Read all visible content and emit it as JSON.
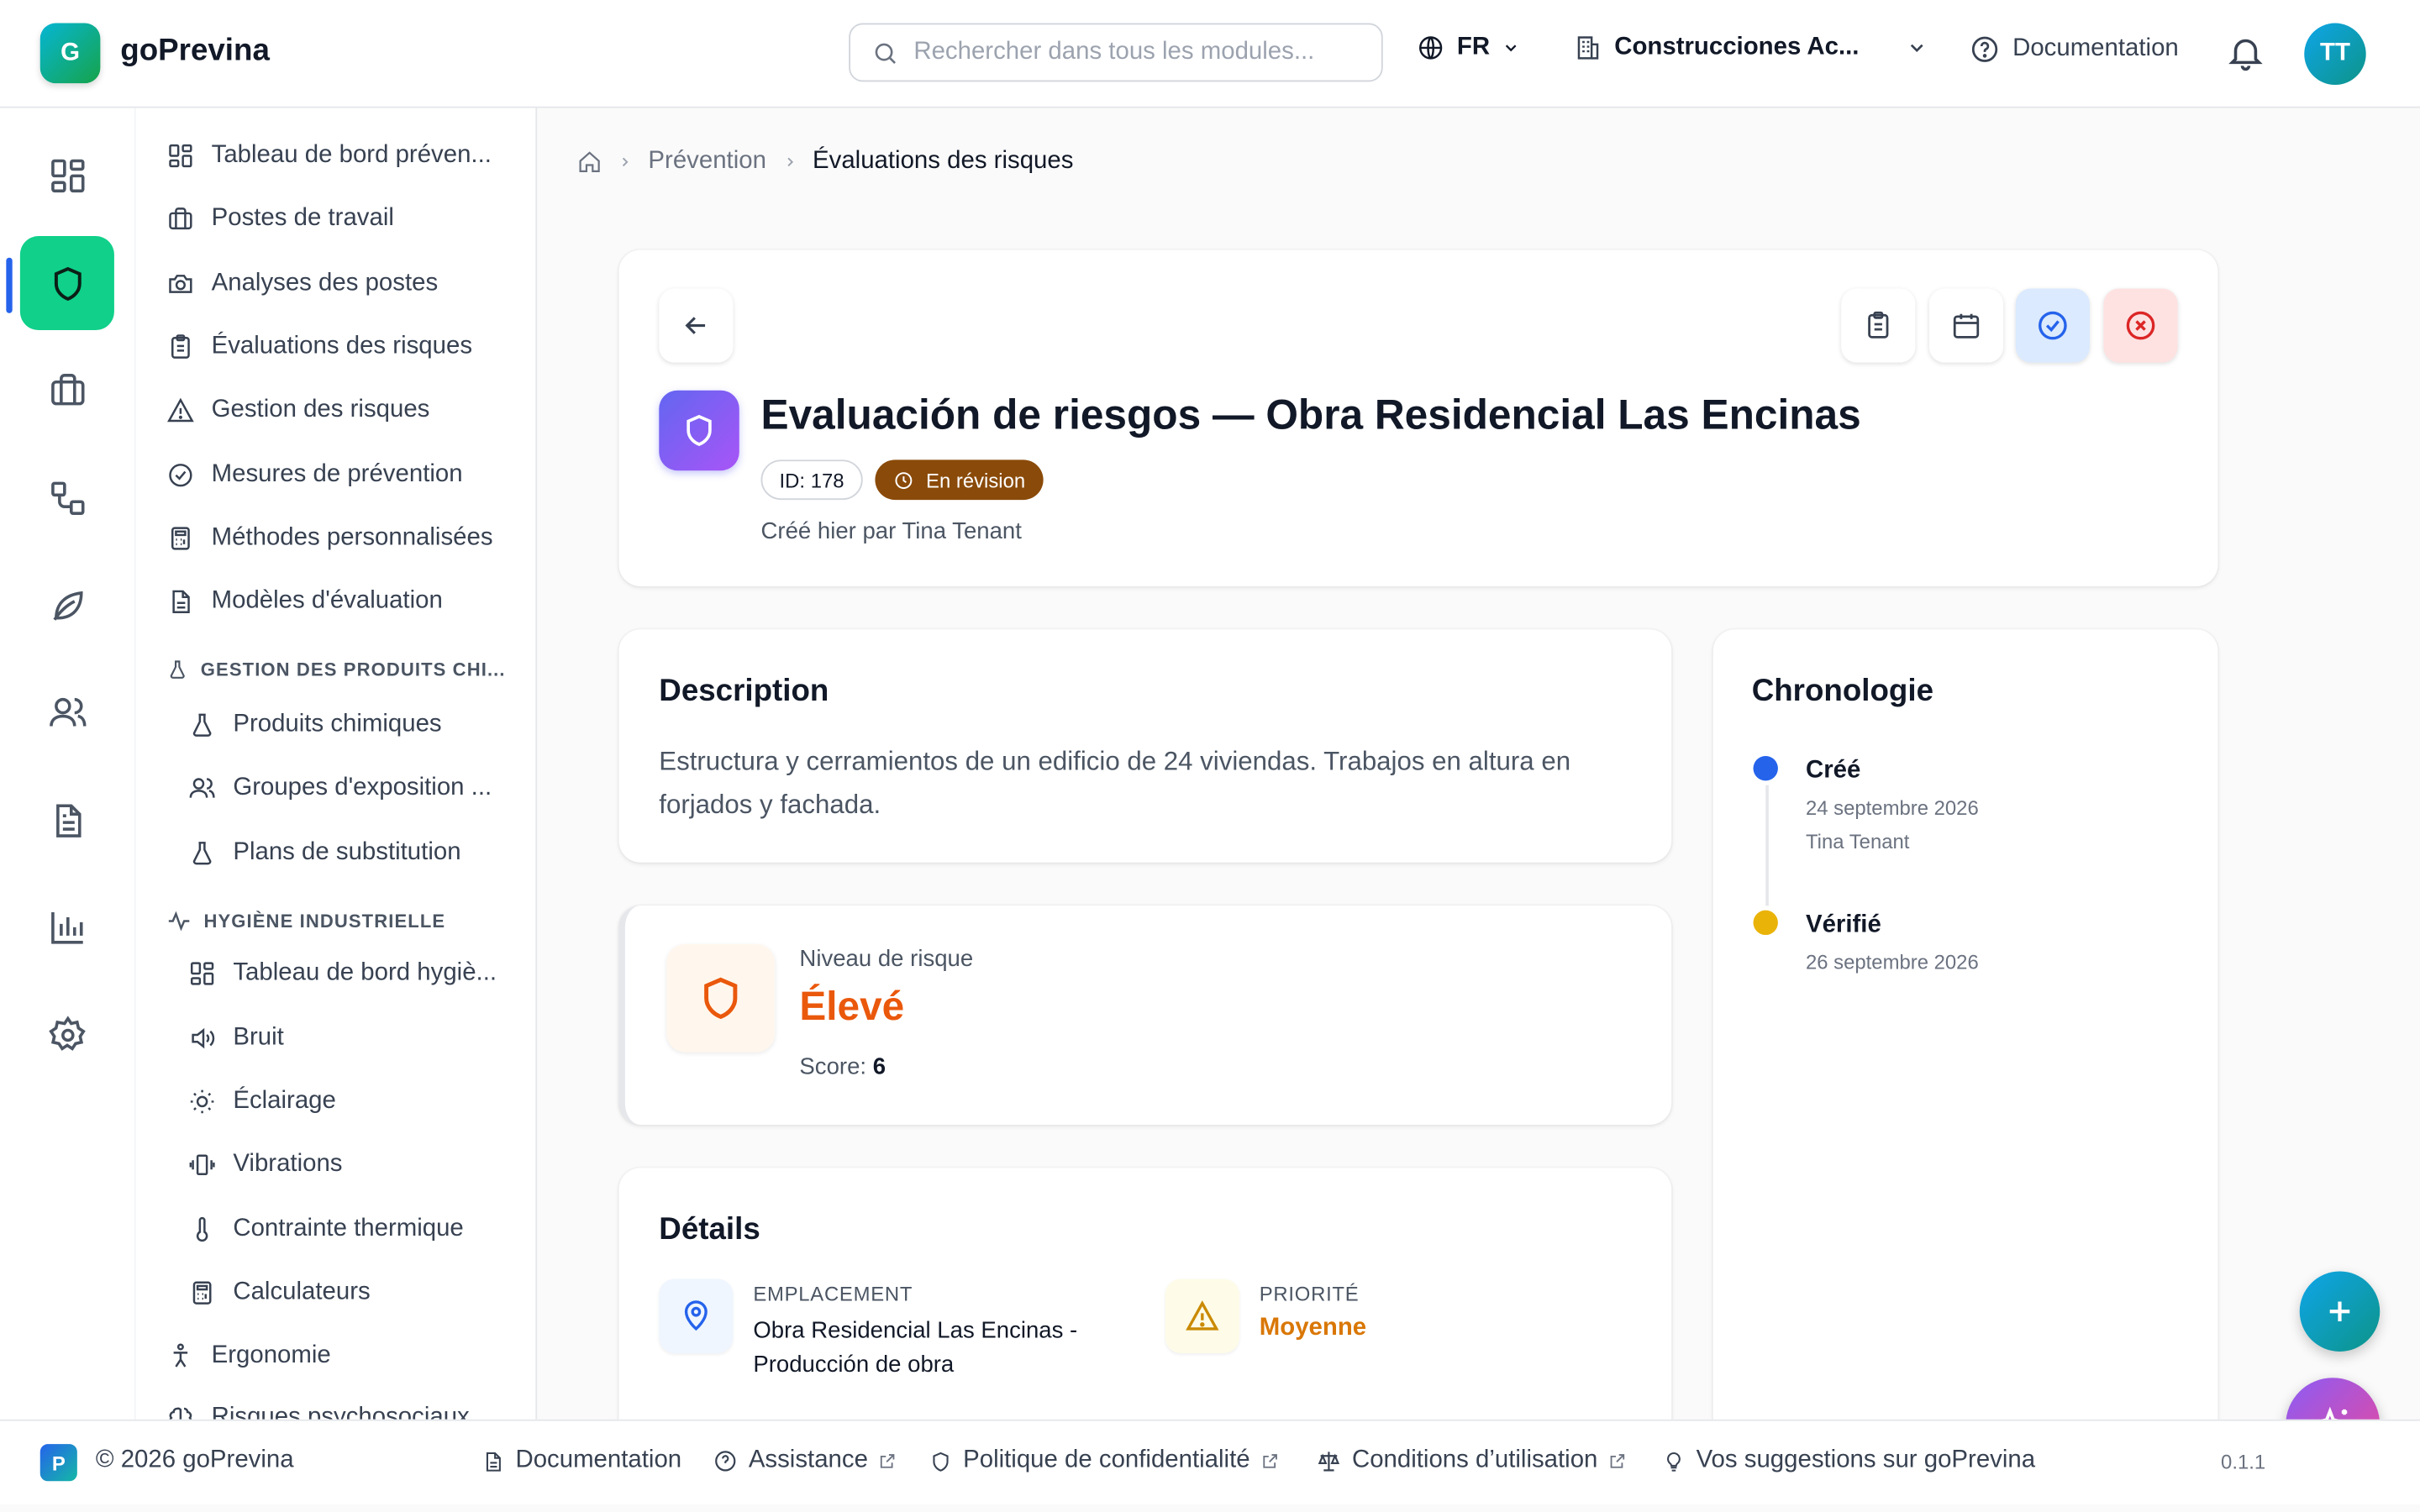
{
  "header": {
    "logo_letter": "G",
    "app_name": "goPrevina",
    "search_placeholder": "Rechercher dans tous les modules...",
    "language": "FR",
    "company": "Construcciones Ac...",
    "documentation": "Documentation",
    "avatar_initials": "TT"
  },
  "rail": {
    "icons": [
      "dashboard-icon",
      "shield-icon",
      "briefcase-icon",
      "workflow-icon",
      "leaf-icon",
      "users-icon",
      "file-text-icon",
      "bar-chart-icon",
      "settings-icon"
    ],
    "active": "shield-icon"
  },
  "sidebar": {
    "items": [
      {
        "label": "Tableau de bord préven...",
        "icon": "dashboard-icon"
      },
      {
        "label": "Postes de travail",
        "icon": "briefcase-icon"
      },
      {
        "label": "Analyses des postes",
        "icon": "camera-icon"
      },
      {
        "label": "Évaluations des risques",
        "icon": "clipboard-icon"
      },
      {
        "label": "Gestion des risques",
        "icon": "warning-icon"
      },
      {
        "label": "Mesures de prévention",
        "icon": "check-circle-icon"
      },
      {
        "label": "Méthodes personnalisées",
        "icon": "calculator-icon"
      },
      {
        "label": "Modèles d'évaluation",
        "icon": "file-icon"
      }
    ],
    "section_chemicals": "GESTION DES PRODUITS CHI...",
    "chemicals": [
      {
        "label": "Produits chimiques",
        "icon": "flask-icon"
      },
      {
        "label": "Groupes d'exposition ...",
        "icon": "users-icon"
      },
      {
        "label": "Plans de substitution",
        "icon": "flask-icon"
      }
    ],
    "section_hygiene": "HYGIÈNE INDUSTRIELLE",
    "hygiene": [
      {
        "label": "Tableau de bord hygiè...",
        "icon": "dashboard-icon"
      },
      {
        "label": "Bruit",
        "icon": "speaker-icon"
      },
      {
        "label": "Éclairage",
        "icon": "sun-icon"
      },
      {
        "label": "Vibrations",
        "icon": "vibration-icon"
      },
      {
        "label": "Contrainte thermique",
        "icon": "thermometer-icon"
      },
      {
        "label": "Calculateurs",
        "icon": "calculator-icon"
      }
    ],
    "ergonomie": "Ergonomie",
    "cut_item": "Risques psychosociaux"
  },
  "breadcrumb": {
    "parent": "Prévention",
    "current": "Évaluations des risques"
  },
  "evaluation": {
    "title": "Evaluación de riesgos — Obra Residencial Las Encinas",
    "id_label": "ID: 178",
    "status": "En révision",
    "created_line": "Créé hier par Tina Tenant",
    "status_color": "#8a4a09"
  },
  "description": {
    "heading": "Description",
    "text": "Estructura y cerramientos de un edificio de 24 viviendas. Trabajos en altura en forjados y fachada."
  },
  "risk": {
    "label": "Niveau de risque",
    "level": "Élevé",
    "score_label": "Score:",
    "score_value": "6",
    "level_color": "#ea580c"
  },
  "details": {
    "heading": "Détails",
    "location_label": "EMPLACEMENT",
    "location_value": "Obra Residencial Las Encinas - Producción de obra",
    "priority_label": "PRIORITÉ",
    "priority_value": "Moyenne",
    "priority_color": "#d97706"
  },
  "timeline": {
    "heading": "Chronologie",
    "events": [
      {
        "title": "Créé",
        "date": "24 septembre 2026",
        "user": "Tina Tenant",
        "color": "#2563eb"
      },
      {
        "title": "Vérifié",
        "date": "26 septembre 2026",
        "user": "",
        "color": "#eab308"
      }
    ]
  },
  "footer": {
    "logo_letter": "P",
    "copyright": "© 2026 goPrevina",
    "documentation": "Documentation",
    "assistance": "Assistance",
    "privacy": "Politique de confidentialité",
    "terms": "Conditions d’utilisation",
    "suggestions": "Vos suggestions sur goPrevina",
    "version": "0.1.1"
  }
}
